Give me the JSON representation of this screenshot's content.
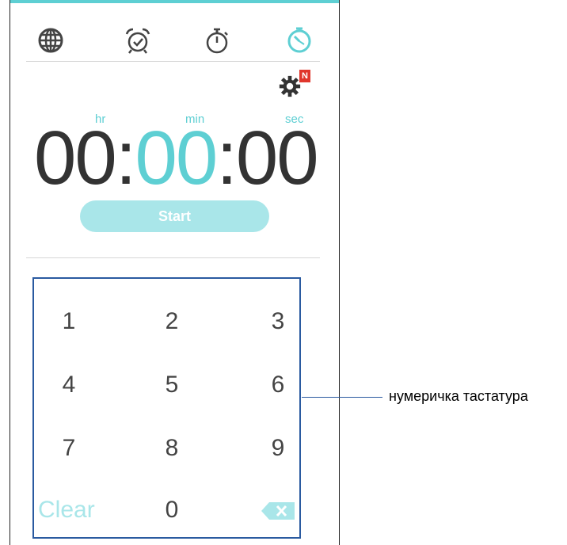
{
  "tabs": [
    {
      "name": "world-clock-icon",
      "active": false
    },
    {
      "name": "alarm-icon",
      "active": false
    },
    {
      "name": "stopwatch-icon",
      "active": false
    },
    {
      "name": "timer-icon",
      "active": true
    }
  ],
  "settings": {
    "badge": "N"
  },
  "units": {
    "hr": "hr",
    "min": "min",
    "sec": "sec"
  },
  "time": {
    "hours": "00",
    "sep1": ":",
    "minutes": "00",
    "sep2": ":",
    "seconds": "00"
  },
  "start_label": "Start",
  "keypad": {
    "keys": [
      "1",
      "2",
      "3",
      "4",
      "5",
      "6",
      "7",
      "8",
      "9"
    ],
    "clear": "Clear",
    "zero": "0"
  },
  "callout": "нумеричка тастатура",
  "colors": {
    "accent": "#5ecfd3",
    "accent_light": "#a9e6e9",
    "frame": "#2a5aa0",
    "badge": "#e0362c"
  }
}
